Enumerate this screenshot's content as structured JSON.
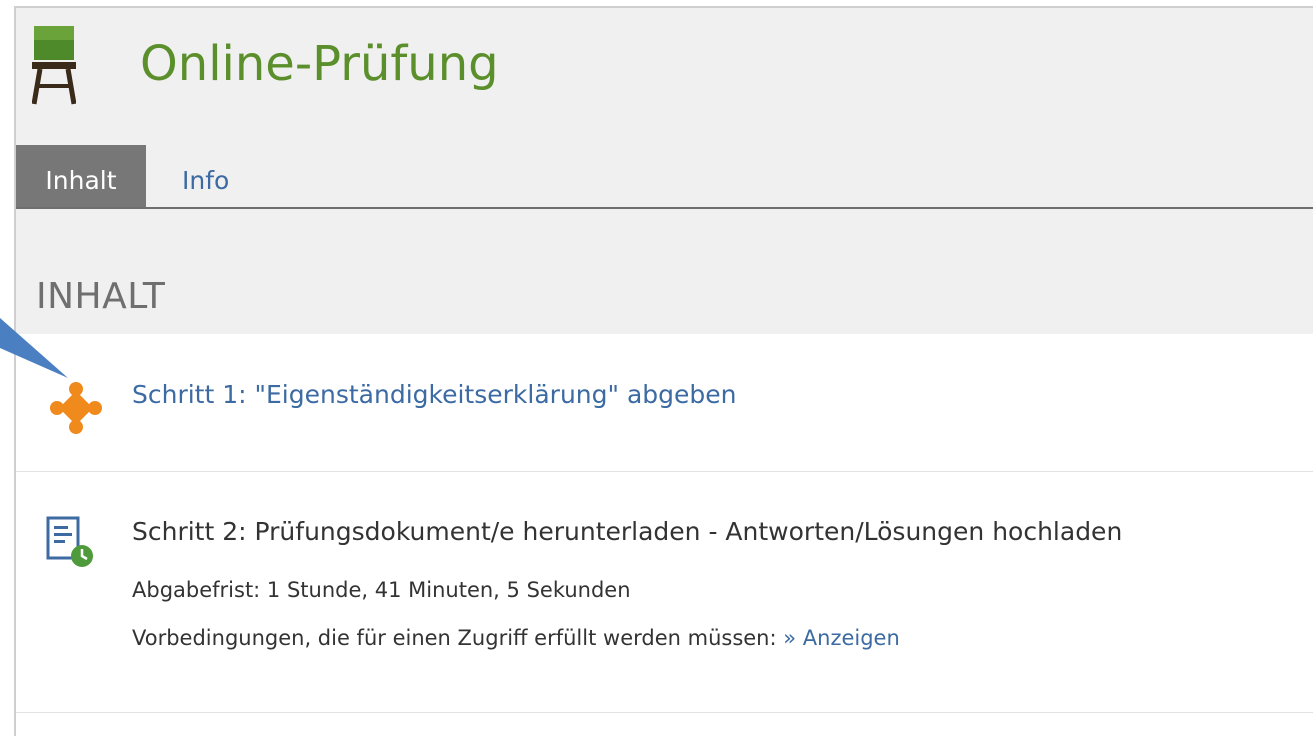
{
  "header": {
    "title": "Online-Prüfung",
    "icon": "exam-desk-icon"
  },
  "tabs": [
    {
      "label": "Inhalt",
      "active": true
    },
    {
      "label": "Info",
      "active": false
    }
  ],
  "section": {
    "heading": "INHALT"
  },
  "items": [
    {
      "icon": "puzzle-icon",
      "title": "Schritt 1: \"Eigenständigkeitserklärung\" abgeben"
    },
    {
      "icon": "assignment-clock-icon",
      "title": "Schritt 2: Prüfungsdokument/e herunterladen - Antworten/Lösungen hochladen",
      "deadline": "Abgabefrist: 1 Stunde, 41 Minuten, 5 Sekunden",
      "preconditions_label": "Vorbedingungen, die für einen Zugriff erfüllt werden müssen:",
      "preconditions_link": "» Anzeigen"
    }
  ],
  "colors": {
    "title_green": "#5b8f2c",
    "link_blue": "#3c6aa2",
    "puzzle_orange": "#f08a1d",
    "active_tab_gray": "#777777",
    "annotation_arrow": "#4a7fc1"
  }
}
